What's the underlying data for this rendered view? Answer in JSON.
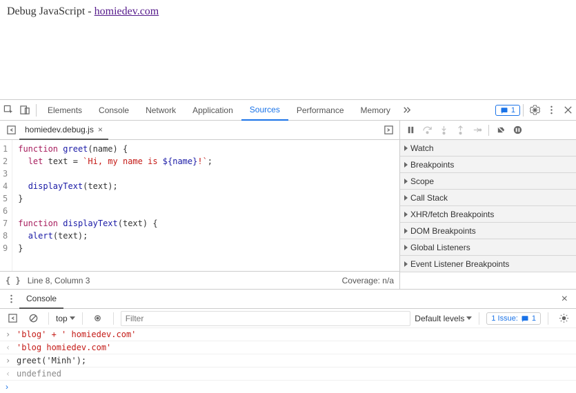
{
  "page": {
    "title_prefix": "Debug JavaScript - ",
    "title_link": "homiedev.com"
  },
  "tabs": {
    "elements": "Elements",
    "console": "Console",
    "network": "Network",
    "application": "Application",
    "sources": "Sources",
    "performance": "Performance",
    "memory": "Memory",
    "active": "sources",
    "badge_count": "1"
  },
  "file": {
    "name": "homiedev.debug.js"
  },
  "code": {
    "lines": [
      {
        "n": "1",
        "html": "<span class='kw'>function</span> <span class='fn'>greet</span>(name) {"
      },
      {
        "n": "2",
        "html": "  <span class='kw'>let</span> text = <span class='str'>`Hi, my name is </span><span class='tmpl'>${name}</span><span class='str'>!`</span>;"
      },
      {
        "n": "3",
        "html": ""
      },
      {
        "n": "4",
        "html": "  <span class='fn'>displayText</span>(text);"
      },
      {
        "n": "5",
        "html": "}"
      },
      {
        "n": "6",
        "html": ""
      },
      {
        "n": "7",
        "html": "<span class='kw'>function</span> <span class='fn'>displayText</span>(text) {"
      },
      {
        "n": "8",
        "html": "  <span class='fn'>alert</span>(text);"
      },
      {
        "n": "9",
        "html": "}"
      }
    ]
  },
  "status": {
    "cursor": "Line 8, Column 3",
    "coverage": "Coverage: n/a"
  },
  "debugger_sections": [
    "Watch",
    "Breakpoints",
    "Scope",
    "Call Stack",
    "XHR/fetch Breakpoints",
    "DOM Breakpoints",
    "Global Listeners",
    "Event Listener Breakpoints"
  ],
  "console": {
    "tab_label": "Console",
    "context": "top",
    "filter_placeholder": "Filter",
    "levels": "Default levels",
    "issue_label": "1 Issue:",
    "issue_count": "1",
    "entries": [
      {
        "dir": "in",
        "text": "'blog' + ' homiedev.com'",
        "cls": "str"
      },
      {
        "dir": "out",
        "text": "'blog homiedev.com'",
        "cls": "str"
      },
      {
        "dir": "in",
        "text": "greet('Minh');",
        "cls": ""
      },
      {
        "dir": "out",
        "text": "undefined",
        "cls": "und"
      }
    ]
  }
}
